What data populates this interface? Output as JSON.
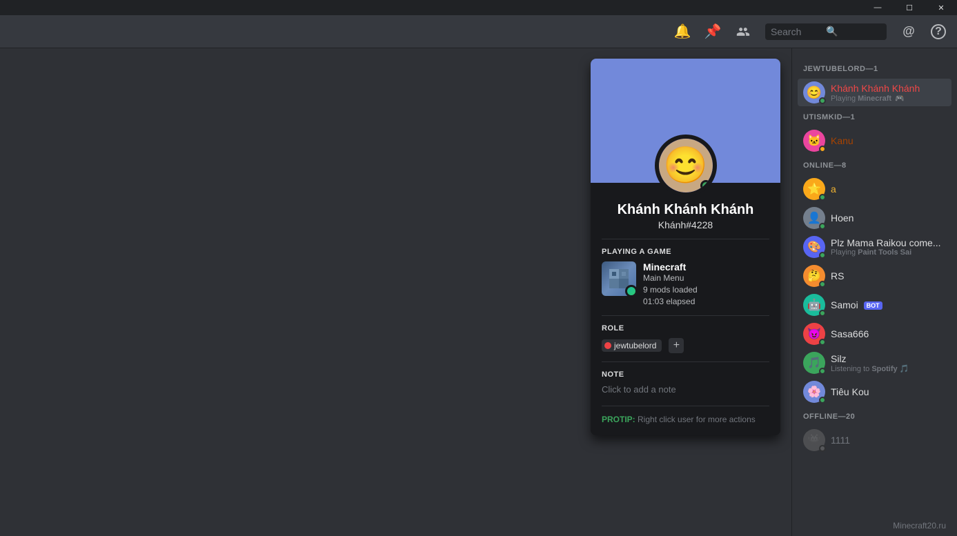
{
  "titlebar": {
    "minimize": "—",
    "maximize": "☐",
    "close": "✕"
  },
  "topbar": {
    "search_placeholder": "Search",
    "icons": {
      "bell": "🔔",
      "pin": "📌",
      "members": "👥",
      "at": "@",
      "help": "?"
    }
  },
  "member_sections": [
    {
      "id": "jewtubelord",
      "header": "JEWTUBELORD—1",
      "members": [
        {
          "name": "Khánh Khánh Khánh",
          "discriminator": "",
          "status": "online",
          "color": "#f04747",
          "subtext": "Playing Minecraft",
          "avatar_color": "purple",
          "active": true
        }
      ]
    },
    {
      "id": "utismkid",
      "header": "UTISMKID—1",
      "members": [
        {
          "name": "Kanu",
          "discriminator": "",
          "status": "idle",
          "color": "#a84300",
          "subtext": "",
          "avatar_color": "pink",
          "active": false
        }
      ]
    },
    {
      "id": "online",
      "header": "ONLINE—8",
      "members": [
        {
          "name": "a",
          "discriminator": "",
          "status": "online",
          "color": "#f0b232",
          "subtext": "",
          "avatar_color": "yellow",
          "active": false
        },
        {
          "name": "Hoen",
          "discriminator": "",
          "status": "online",
          "color": "#dcddde",
          "subtext": "",
          "avatar_color": "grey",
          "active": false
        },
        {
          "name": "Plz Mama Raikou come...",
          "discriminator": "",
          "status": "online",
          "color": "#dcddde",
          "subtext": "Playing Paint Tools Sai",
          "avatar_color": "blue",
          "active": false
        },
        {
          "name": "RS",
          "discriminator": "",
          "status": "online",
          "color": "#dcddde",
          "subtext": "",
          "avatar_color": "orange",
          "active": false
        },
        {
          "name": "Samoi",
          "discriminator": "",
          "status": "online",
          "color": "#dcddde",
          "subtext": "",
          "avatar_color": "teal",
          "is_bot": true,
          "active": false
        },
        {
          "name": "Sasa666",
          "discriminator": "",
          "status": "online",
          "color": "#dcddde",
          "subtext": "",
          "avatar_color": "red",
          "active": false
        },
        {
          "name": "Silz",
          "discriminator": "",
          "status": "online",
          "color": "#dcddde",
          "subtext": "Listening to Spotify",
          "avatar_color": "green",
          "active": false
        },
        {
          "name": "Tiêu Kou",
          "discriminator": "",
          "status": "online",
          "color": "#dcddde",
          "subtext": "",
          "avatar_color": "purple",
          "active": false
        }
      ]
    },
    {
      "id": "offline",
      "header": "OFFLINE—20",
      "members": [
        {
          "name": "1111",
          "discriminator": "",
          "status": "offline",
          "color": "#72767d",
          "subtext": "",
          "avatar_color": "blue",
          "active": false
        }
      ]
    }
  ],
  "profile_popup": {
    "username": "Khánh Khánh Khánh",
    "discriminator": "Khánh#4228",
    "activity_section": "PLAYING A GAME",
    "game": {
      "name": "Minecraft",
      "detail1": "Main Menu",
      "detail2": "9 mods loaded",
      "detail3": "01:03 elapsed"
    },
    "role_section": "ROLE",
    "role_tag": "jewtubelord",
    "note_section": "NOTE",
    "note_placeholder": "Click to add a note",
    "protip_label": "PROTIP:",
    "protip_text": " Right click user for more actions"
  },
  "footer_label": "Minecraft20.ru"
}
